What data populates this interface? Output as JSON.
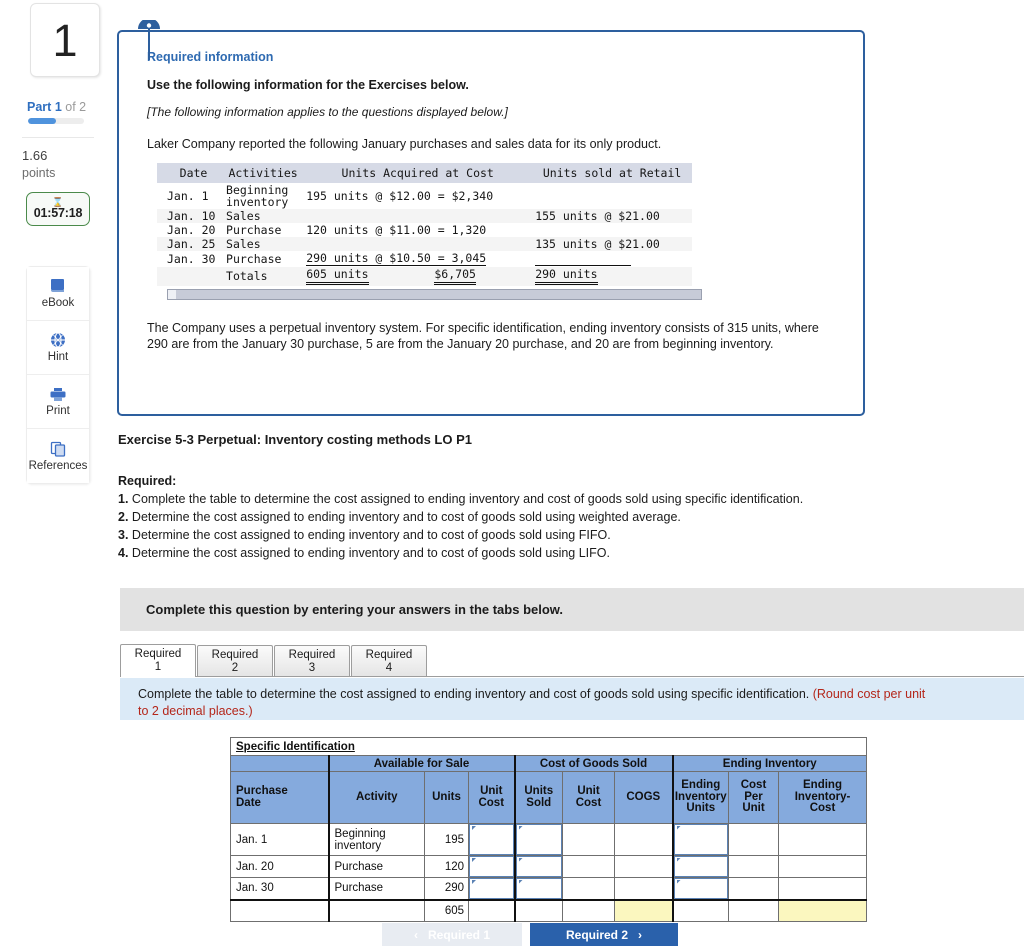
{
  "rail": {
    "question_number": "1",
    "part_prefix": "Part",
    "part_current": "1",
    "part_of": "of 2",
    "points_value": "1.66",
    "points_label": "points",
    "timer_icon": "hourglass-icon",
    "timer_value": "01:57:18",
    "tools": [
      {
        "icon": "ebook-icon",
        "label": "eBook"
      },
      {
        "icon": "hint-icon",
        "label": "Hint"
      },
      {
        "icon": "print-icon",
        "label": "Print"
      },
      {
        "icon": "references-icon",
        "label": "References"
      }
    ],
    "accent_blue": "#2f6fc0",
    "timer_green": "#4a8a4a"
  },
  "required_info": {
    "panel_border_color": "#2d5f9e",
    "title": "Required information",
    "subtitle": "Use the following information for the Exercises below.",
    "italic_note": "[The following information applies to the questions displayed below.]",
    "intro": "Laker Company reported the following January purchases and sales data for its only product.",
    "footer": "The Company uses a perpetual inventory system. For specific identification, ending inventory consists of 315 units, where 290 are from the January 30 purchase, 5 are from the January 20 purchase, and 20 are from beginning inventory."
  },
  "info_table": {
    "headers": [
      "Date",
      "Activities",
      "Units Acquired at Cost",
      "Units sold at Retail"
    ],
    "rows": [
      {
        "date": "Jan.  1",
        "activity": "Beginning inventory",
        "acquired": "195 units @ $12.00 = $2,340",
        "sold": ""
      },
      {
        "date": "Jan. 10",
        "activity": "Sales",
        "acquired": "",
        "sold": "155 units @ $21.00"
      },
      {
        "date": "Jan. 20",
        "activity": "Purchase",
        "acquired": "120 units @ $11.00 =  1,320",
        "sold": ""
      },
      {
        "date": "Jan. 25",
        "activity": "Sales",
        "acquired": "",
        "sold": "135 units @ $21.00"
      },
      {
        "date": "Jan. 30",
        "activity": "Purchase",
        "acquired": "290 units @ $10.50 =  3,045",
        "sold": ""
      }
    ],
    "totals": {
      "label": "Totals",
      "units": "605 units",
      "cost": "$6,705",
      "sold": "290 units"
    }
  },
  "exercise": {
    "title": "Exercise 5-3 Perpetual: Inventory costing methods LO P1",
    "required_label": "Required:",
    "items": [
      {
        "num": "1.",
        "text": "Complete the table to determine the cost assigned to ending inventory and cost of goods sold using specific identification."
      },
      {
        "num": "2.",
        "text": "Determine the cost assigned to ending inventory and to cost of goods sold using weighted average."
      },
      {
        "num": "3.",
        "text": "Determine the cost assigned to ending inventory and to cost of goods sold using FIFO."
      },
      {
        "num": "4.",
        "text": "Determine the cost assigned to ending inventory and to cost of goods sold using LIFO."
      }
    ]
  },
  "grey_banner": {
    "text": "Complete this question by entering your answers in the tabs below."
  },
  "tabs": [
    {
      "line1": "Required",
      "line2": "1",
      "active": true
    },
    {
      "line1": "Required",
      "line2": "2",
      "active": false
    },
    {
      "line1": "Required",
      "line2": "3",
      "active": false
    },
    {
      "line1": "Required",
      "line2": "4",
      "active": false
    }
  ],
  "instruction": {
    "text": "Complete the table to determine the cost assigned to ending inventory and cost of goods sold using specific identification. ",
    "rounding_note": "(Round cost per unit to 2 decimal places.)",
    "note_color": "#b4261a",
    "background": "#dbeaf7"
  },
  "answer_table": {
    "caption": "Specific Identification",
    "group_headers": [
      "",
      "Available for Sale",
      "Cost of Goods Sold",
      "Ending Inventory"
    ],
    "column_headers": [
      "Purchase Date",
      "Activity",
      "Units",
      "Unit Cost",
      "Units Sold",
      "Unit Cost",
      "COGS",
      "Ending Inventory Units",
      "Cost Per Unit",
      "Ending Inventory- Cost"
    ],
    "header_fill": "#85aadd",
    "highlight_fill": "#fbf7bf",
    "rows": [
      {
        "date": "Jan. 1",
        "activity": "Beginning inventory",
        "units": "195"
      },
      {
        "date": "Jan. 20",
        "activity": "Purchase",
        "units": "120"
      },
      {
        "date": "Jan. 30",
        "activity": "Purchase",
        "units": "290"
      }
    ],
    "total_units": "605"
  },
  "footer_nav": {
    "prev_label": "Required 1",
    "prev_chevron": "‹",
    "next_label": "Required 2",
    "next_chevron": "›",
    "next_color": "#2a61ab"
  }
}
